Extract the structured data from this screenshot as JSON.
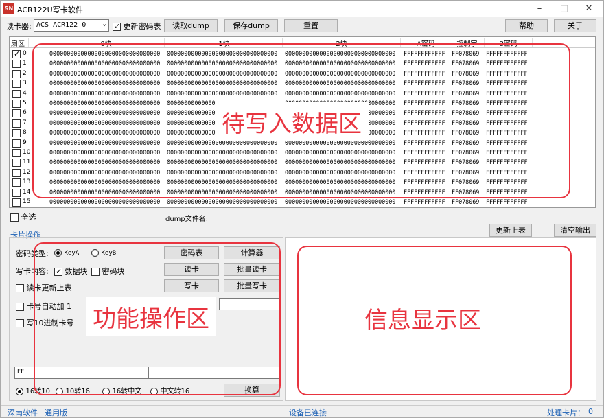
{
  "titlebar": {
    "title": "ACR122U写卡软件",
    "icon_text": "SN"
  },
  "toolbar": {
    "reader_label": "读卡器:",
    "reader_value": "ACS ACR122 0",
    "update_pwd_label": "更新密码表",
    "read_dump": "读取dump",
    "save_dump": "保存dump",
    "reset": "重置",
    "help": "帮助",
    "close": "关于"
  },
  "grid": {
    "headers": [
      "扇区",
      "0块",
      "1块",
      "2块",
      "A密码",
      "控制字",
      "B密码"
    ],
    "rows": [
      {
        "id": "0",
        "checked": true,
        "b0": "00000000000000000000000000000000",
        "b1": "00000000000000000000000000000000",
        "b2": "00000000000000000000000000000000",
        "a": "FFFFFFFFFFFF",
        "c": "FF078069",
        "b": "FFFFFFFFFFFF"
      },
      {
        "id": "1",
        "checked": false,
        "b0": "00000000000000000000000000000000",
        "b1": "00000000000000000000000000000000",
        "b2": "00000000000000000000000000000000",
        "a": "FFFFFFFFFFFF",
        "c": "FF078069",
        "b": "FFFFFFFFFFFF"
      },
      {
        "id": "2",
        "checked": false,
        "b0": "00000000000000000000000000000000",
        "b1": "00000000000000000000000000000000",
        "b2": "00000000000000000000000000000000",
        "a": "FFFFFFFFFFFF",
        "c": "FF078069",
        "b": "FFFFFFFFFFFF"
      },
      {
        "id": "3",
        "checked": false,
        "b0": "00000000000000000000000000000000",
        "b1": "00000000000000000000000000000000",
        "b2": "00000000000000000000000000000000",
        "a": "FFFFFFFFFFFF",
        "c": "FF078069",
        "b": "FFFFFFFFFFFF"
      },
      {
        "id": "4",
        "checked": false,
        "b0": "00000000000000000000000000000000",
        "b1": "00000000000000000000000000000000",
        "b2": "00000000000000000000000000000000",
        "a": "FFFFFFFFFFFF",
        "c": "FF078069",
        "b": "FFFFFFFFFFFF"
      },
      {
        "id": "5",
        "checked": false,
        "b0": "00000000000000000000000000000000",
        "b1": "00000000000000",
        "b2": "00000000000000000000000000000000",
        "a": "FFFFFFFFFFFF",
        "c": "FF078069",
        "b": "FFFFFFFFFFFF"
      },
      {
        "id": "6",
        "checked": false,
        "b0": "00000000000000000000000000000000",
        "b1": "00000000000000",
        "b2": "00000000000000000000000000000000",
        "a": "FFFFFFFFFFFF",
        "c": "FF078069",
        "b": "FFFFFFFFFFFF"
      },
      {
        "id": "7",
        "checked": false,
        "b0": "00000000000000000000000000000000",
        "b1": "00000000000000",
        "b2": "00000000000000000000000000000000",
        "a": "FFFFFFFFFFFF",
        "c": "FF078069",
        "b": "FFFFFFFFFFFF"
      },
      {
        "id": "8",
        "checked": false,
        "b0": "00000000000000000000000000000000",
        "b1": "00000000000000",
        "b2": "00000000000000000000000000000000",
        "a": "FFFFFFFFFFFF",
        "c": "FF078069",
        "b": "FFFFFFFFFFFF"
      },
      {
        "id": "9",
        "checked": false,
        "b0": "00000000000000000000000000000000",
        "b1": "00000000000000000000000000000000",
        "b2": "00000000000000000000000000000000",
        "a": "FFFFFFFFFFFF",
        "c": "FF078069",
        "b": "FFFFFFFFFFFF"
      },
      {
        "id": "10",
        "checked": false,
        "b0": "00000000000000000000000000000000",
        "b1": "00000000000000000000000000000000",
        "b2": "00000000000000000000000000000000",
        "a": "FFFFFFFFFFFF",
        "c": "FF078069",
        "b": "FFFFFFFFFFFF"
      },
      {
        "id": "11",
        "checked": false,
        "b0": "00000000000000000000000000000000",
        "b1": "00000000000000000000000000000000",
        "b2": "00000000000000000000000000000000",
        "a": "FFFFFFFFFFFF",
        "c": "FF078069",
        "b": "FFFFFFFFFFFF"
      },
      {
        "id": "12",
        "checked": false,
        "b0": "00000000000000000000000000000000",
        "b1": "00000000000000000000000000000000",
        "b2": "00000000000000000000000000000000",
        "a": "FFFFFFFFFFFF",
        "c": "FF078069",
        "b": "FFFFFFFFFFFF"
      },
      {
        "id": "13",
        "checked": false,
        "b0": "00000000000000000000000000000000",
        "b1": "00000000000000000000000000000000",
        "b2": "00000000000000000000000000000000",
        "a": "FFFFFFFFFFFF",
        "c": "FF078069",
        "b": "FFFFFFFFFFFF"
      },
      {
        "id": "14",
        "checked": false,
        "b0": "00000000000000000000000000000000",
        "b1": "00000000000000000000000000000000",
        "b2": "00000000000000000000000000000000",
        "a": "FFFFFFFFFFFF",
        "c": "FF078069",
        "b": "FFFFFFFFFFFF"
      },
      {
        "id": "15",
        "checked": false,
        "b0": "00000000000000000000000000000000",
        "b1": "00000000000000000000000000000000",
        "b2": "00000000000000000000000000000000",
        "a": "FFFFFFFFFFFF",
        "c": "FF078069",
        "b": "FFFFFFFFFFFF"
      }
    ]
  },
  "under_grid": {
    "select_all": "全选",
    "dump_file_label": "dump文件名:",
    "update_table": "更新上表",
    "clear_output": "清空输出"
  },
  "card_ops": {
    "section_title": "卡片操作",
    "pwd_type_label": "密码类型:",
    "key_a": "KeyA",
    "key_b": "KeyB",
    "pwd_table_btn": "密码表",
    "calc_btn": "计算器",
    "write_content_label": "写卡内容:",
    "data_block": "数据块",
    "pwd_block": "密码块",
    "read_card_btn": "读卡",
    "batch_read_btn": "批量读卡",
    "read_update_label": "读卡更新上表",
    "write_card_btn": "写卡",
    "batch_write_btn": "批量写卡",
    "auto_inc_label": "卡号自动加 1",
    "write_dec_label": "写10进制卡号",
    "convert_input_value": "FF",
    "radio_16_10": "16转10",
    "radio_10_16": "10转16",
    "radio_16_cn": "16转中文",
    "radio_cn_16": "中文转16",
    "convert_btn": "换算"
  },
  "overlays": {
    "data_area": "待写入数据区",
    "func_area": "功能操作区",
    "info_area": "信息显示区"
  },
  "status": {
    "left1": "深南软件",
    "left2": "通用版",
    "center": "设备已连接",
    "right_label": "处理卡片：",
    "right_count": "0"
  },
  "colors": {
    "annotation_red": "#e8343f",
    "link_blue": "#1a5fb4",
    "icon_red": "#c9322b"
  }
}
